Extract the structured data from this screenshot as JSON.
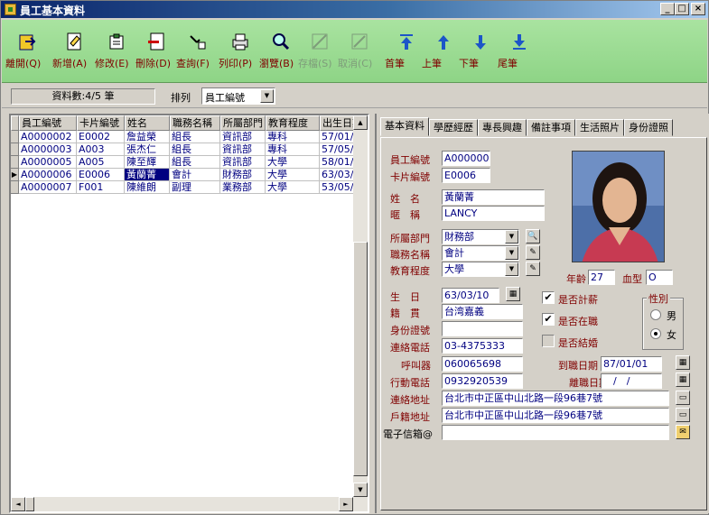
{
  "window": {
    "title": "員工基本資料",
    "min": "_",
    "max": "□",
    "close": "×"
  },
  "toolbar": {
    "items": [
      {
        "label": "離開(Q)",
        "icon": "exit-icon",
        "enabled": true
      },
      {
        "label": "新增(A)",
        "icon": "new-icon",
        "enabled": true
      },
      {
        "label": "修改(E)",
        "icon": "edit-icon",
        "enabled": true
      },
      {
        "label": "刪除(D)",
        "icon": "delete-icon",
        "enabled": true
      },
      {
        "label": "查詢(F)",
        "icon": "query-icon",
        "enabled": true
      },
      {
        "label": "列印(P)",
        "icon": "print-icon",
        "enabled": true
      },
      {
        "label": "瀏覽(B)",
        "icon": "browse-icon",
        "enabled": true
      },
      {
        "label": "存檔(S)",
        "icon": "save-icon",
        "enabled": false
      },
      {
        "label": "取消(C)",
        "icon": "cancel-icon",
        "enabled": false
      },
      {
        "label": "首筆",
        "icon": "first-record-icon",
        "enabled": true
      },
      {
        "label": "上筆",
        "icon": "prev-record-icon",
        "enabled": true
      },
      {
        "label": "下筆",
        "icon": "next-record-icon",
        "enabled": true
      },
      {
        "label": "尾筆",
        "icon": "last-record-icon",
        "enabled": true
      }
    ]
  },
  "status": {
    "count": "資料數:4/5 筆",
    "sort_label": "排列",
    "sort_value": "員工編號"
  },
  "grid": {
    "columns": [
      "員工編號",
      "卡片編號",
      "姓名",
      "職務名稱",
      "所屬部門",
      "教育程度",
      "出生日期"
    ],
    "rows": [
      [
        "A0000002",
        "E0002",
        "詹益榮",
        "組長",
        "資訊部",
        "專科",
        "57/01/0"
      ],
      [
        "A0000003",
        "A003",
        "張杰仁",
        "組長",
        "資訊部",
        "專科",
        "57/05/0"
      ],
      [
        "A0000005",
        "A005",
        "陳至輝",
        "組長",
        "資訊部",
        "大學",
        "58/01/0"
      ],
      [
        "A0000006",
        "E0006",
        "黃蘭菁",
        "會計",
        "財務部",
        "大學",
        "63/03/1"
      ],
      [
        "A0000007",
        "F001",
        "陳維朗",
        "副理",
        "業務部",
        "大學",
        "53/05/3"
      ]
    ],
    "selected_row": 3
  },
  "tabs": [
    "基本資料",
    "學歷經歷",
    "專長興趣",
    "備註事項",
    "生活照片",
    "身份證照"
  ],
  "form": {
    "emp_no_label": "員工編號",
    "emp_no": "A0000006",
    "card_no_label": "卡片編號",
    "card_no": "E0006",
    "name_label": "姓　名",
    "name": "黃蘭菁",
    "nick_label": "暱　稱",
    "nick": "LANCY",
    "dept_label": "所屬部門",
    "dept": "財務部",
    "job_label": "職務名稱",
    "job": "會計",
    "edu_label": "教育程度",
    "edu": "大學",
    "age_label": "年齡",
    "age": "27",
    "blood_label": "血型",
    "blood": "O",
    "birth_label": "生　日",
    "birth": "63/03/10",
    "native_label": "籍　貫",
    "native": "台湾嘉義",
    "id_label": "身份證號",
    "id": "",
    "phone_label": "連絡電話",
    "phone": "03-4375333",
    "pager_label": "呼叫器",
    "pager": "060065698",
    "mobile_label": "行動電話",
    "mobile": "0932920539",
    "addr_label": "連絡地址",
    "addr": "台北市中正區中山北路一段96巷7號",
    "reg_addr_label": "戶籍地址",
    "reg_addr": "台北市中正區中山北路一段96巷7號",
    "email_label": "電子信箱@",
    "email": "",
    "start_label": "到職日期",
    "start": "87/01/01",
    "leave_label": "離職日期",
    "leave": "　/　/",
    "salary_label": "是否計薪",
    "active_label": "是否在職",
    "married_label": "是否結婚",
    "gender_title": "性別",
    "male": "男",
    "female": "女"
  },
  "colors": {
    "toolbar_bg": "#9edc94",
    "title_bar": "#0a246a",
    "selected_row": "#000080",
    "label": "#800000",
    "value": "#000080"
  }
}
